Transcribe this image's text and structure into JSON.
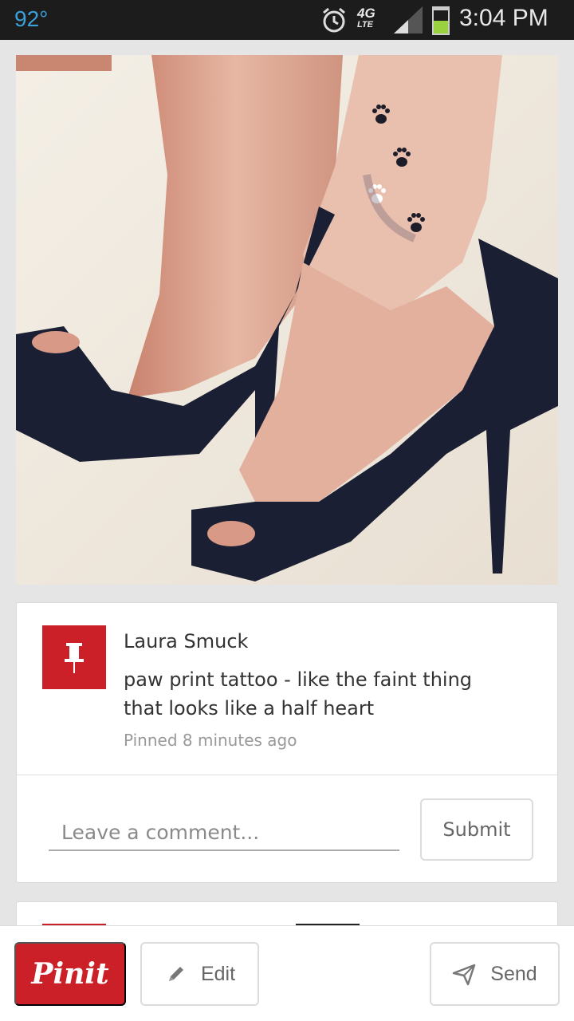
{
  "status_bar": {
    "temperature": "92°",
    "network_type": "4G",
    "network_sub": "LTE",
    "battery_level": 0.55,
    "time": "3:04 PM",
    "icons": [
      "alarm-icon",
      "signal-icon",
      "battery-icon"
    ],
    "colors": {
      "temperature": "#3aa0d8",
      "battery": "#9ad13f"
    }
  },
  "pin": {
    "image": "paw-print-tattoo-photo",
    "author": "Laura Smuck",
    "description": "paw print tattoo - like the faint thing that looks like a half heart",
    "pinned_time": "Pinned 8 minutes ago",
    "avatar_icon": "pushpin-icon"
  },
  "comment": {
    "placeholder": "Leave a comment...",
    "value": "",
    "submit_label": "Submit"
  },
  "actions": {
    "pinit_label": "Pinit",
    "edit_label": "Edit",
    "send_label": "Send",
    "edit_icon": "pencil-icon",
    "send_icon": "paper-plane-icon"
  },
  "colors": {
    "brand_red": "#cb2027",
    "background": "#e5e5e5"
  }
}
